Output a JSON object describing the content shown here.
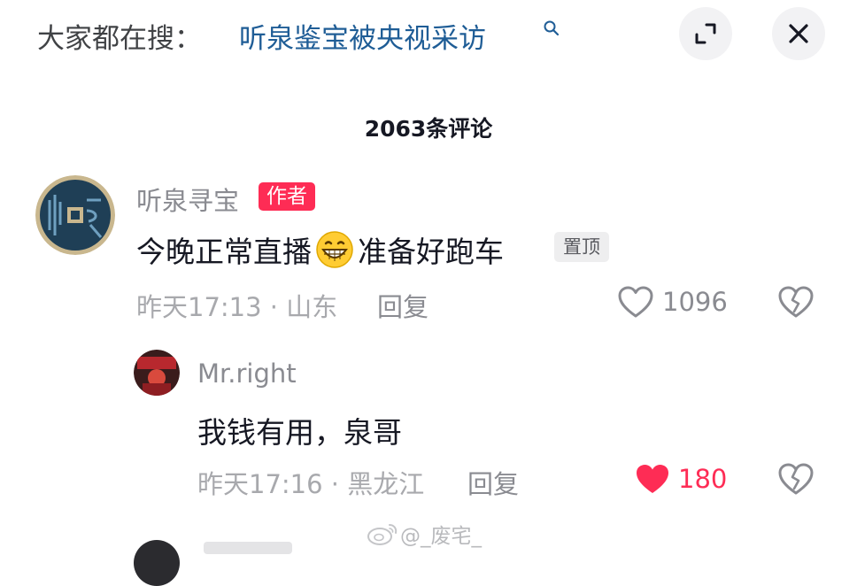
{
  "search": {
    "prefix": "大家都在搜：",
    "term": "听泉鉴宝被央视采访",
    "icon": "search-icon"
  },
  "header": {
    "comment_count": "2063条评论",
    "expand_icon": "expand-icon",
    "close_icon": "close-icon"
  },
  "comments": [
    {
      "username": "听泉寻宝",
      "badge": "作者",
      "text_before_emoji": "今晚正常直播",
      "emoji": "grinning-face",
      "text_after_emoji": "准备好跑车",
      "pin_label": "置顶",
      "meta": "昨天17:13 · 山东",
      "reply_label": "回复",
      "likes": "1096",
      "liked": false
    }
  ],
  "replies": [
    {
      "username": "Mr.right",
      "text": "我钱有用，泉哥",
      "meta": "昨天17:16 · 黑龙江",
      "reply_label": "回复",
      "likes": "180",
      "liked": true
    }
  ],
  "watermark": {
    "text": "@_废宅_"
  },
  "colors": {
    "accent": "#fe2c55",
    "search_link": "#1f5d96",
    "muted": "#8a8b91"
  }
}
